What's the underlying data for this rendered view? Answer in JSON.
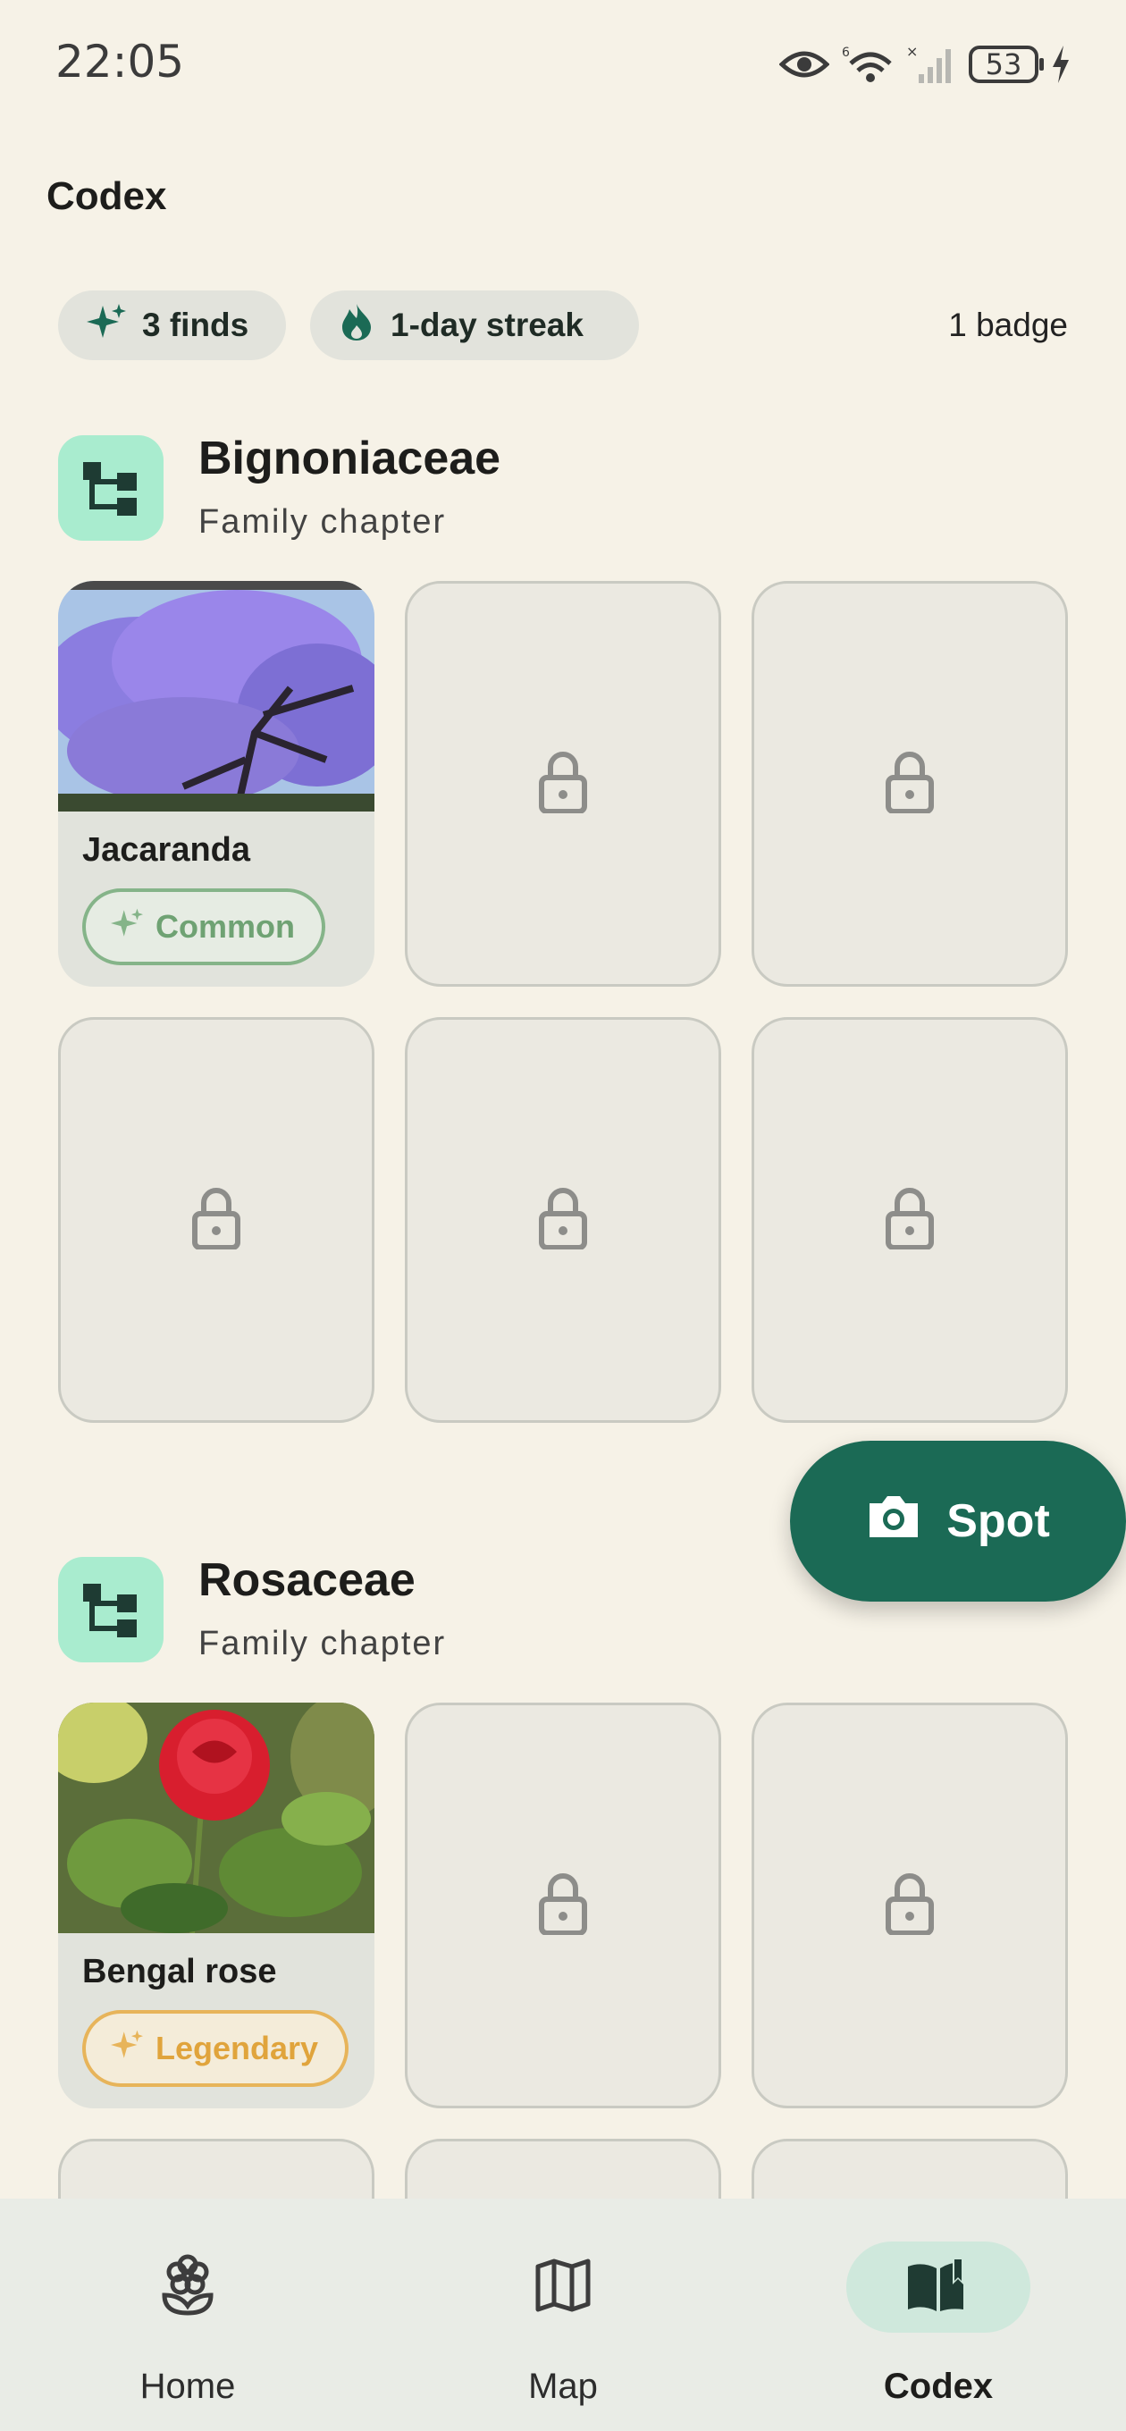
{
  "status_bar": {
    "time": "22:05",
    "battery": "53",
    "icons": [
      "eye-icon",
      "wifi-icon",
      "signal-icon",
      "battery-icon",
      "charging-icon"
    ]
  },
  "header": {
    "title": "Codex"
  },
  "stats": {
    "finds": "3 finds",
    "streak": "1-day streak",
    "badges": "1 badge"
  },
  "families": [
    {
      "name": "Bignoniaceae",
      "subtitle": "Family chapter",
      "found": {
        "name": "Jacaranda",
        "rarity": "Common"
      }
    },
    {
      "name": "Rosaceae",
      "subtitle": "Family chapter",
      "found": {
        "name": "Bengal rose",
        "rarity": "Legendary"
      }
    }
  ],
  "fab": {
    "label": "Spot"
  },
  "nav": [
    {
      "label": "Home",
      "icon": "flower-icon"
    },
    {
      "label": "Map",
      "icon": "map-icon"
    },
    {
      "label": "Codex",
      "icon": "book-icon",
      "active": true
    }
  ],
  "colors": {
    "background": "#f6f2e7",
    "accent": "#1b6a55",
    "family_icon_bg": "#a9eccf",
    "common": "#6fa273",
    "legendary": "#e0a43c"
  }
}
